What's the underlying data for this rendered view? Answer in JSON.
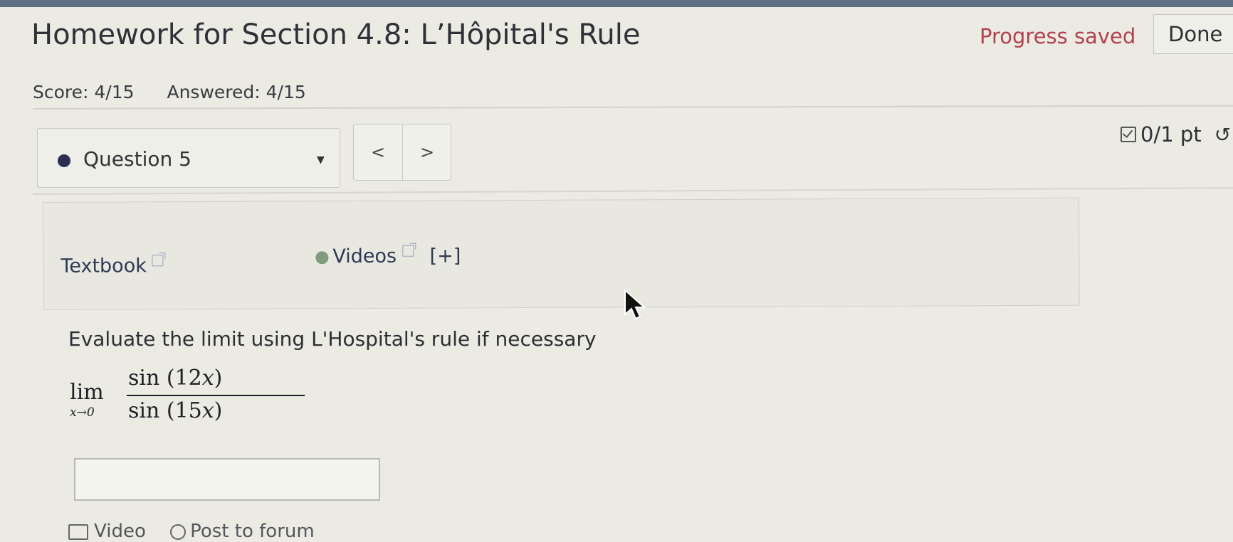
{
  "header": {
    "title": "Homework for Section 4.8: L’Hôpital's Rule",
    "progress_status": "Progress saved",
    "done_label": "Done",
    "score": "Score: 4/15",
    "answered": "Answered: 4/15"
  },
  "question_nav": {
    "selected": "Question 5",
    "prev_label": "<",
    "next_label": ">",
    "points": "0/1 pt"
  },
  "resources": {
    "textbook_label": "Textbook",
    "videos_label": "Videos",
    "videos_expand": "[+]"
  },
  "problem": {
    "instruction": "Evaluate the limit using L'Hospital's rule if necessary",
    "lim": "lim",
    "lim_sub": "x→0",
    "numerator_func": "sin",
    "numerator_arg": "(12",
    "numerator_var": "x",
    "numerator_close": ")",
    "denominator_func": "sin",
    "denominator_arg": "(15",
    "denominator_var": "x",
    "denominator_close": ")"
  },
  "answer": {
    "value": ""
  },
  "help": {
    "video_label": "Video",
    "forum_label": "Post to forum"
  },
  "colors": {
    "background": "#ebebe3",
    "progress_saved": "#b3404e",
    "top_bar": "#5d7183"
  },
  "icons": [
    "checkbox-icon",
    "retry-icon",
    "external-link-icon",
    "video-icon",
    "dropdown-caret-icon",
    "mouse-cursor-icon"
  ]
}
